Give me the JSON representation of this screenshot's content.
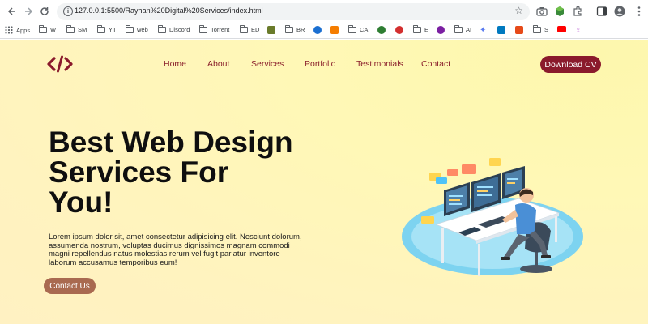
{
  "browser": {
    "url": "127.0.0.1:5500/Rayhan%20Digital%20Services/index.html",
    "bookmarks": [
      {
        "label": "Apps",
        "icon": "apps-grid-icon"
      },
      {
        "label": "W",
        "icon": "folder-icon"
      },
      {
        "label": "SM",
        "icon": "folder-icon"
      },
      {
        "label": "YT",
        "icon": "folder-icon"
      },
      {
        "label": "web",
        "icon": "folder-icon"
      },
      {
        "label": "Discord",
        "icon": "folder-icon"
      },
      {
        "label": "Torrent",
        "icon": "folder-icon"
      },
      {
        "label": "ED",
        "icon": "folder-icon"
      },
      {
        "label": "BR",
        "icon": "folder-icon"
      },
      {
        "label": "CA",
        "icon": "folder-icon"
      },
      {
        "label": "E",
        "icon": "folder-icon"
      },
      {
        "label": "AI",
        "icon": "folder-icon"
      },
      {
        "label": "S",
        "icon": "folder-icon"
      }
    ]
  },
  "header": {
    "logo_icon": "code-brackets-icon",
    "nav": [
      "Home",
      "About",
      "Services",
      "Portfolio",
      "Testimonials",
      "Contact"
    ],
    "cta_label": "Download CV"
  },
  "hero": {
    "title_lines": [
      "Best Web Design",
      "Services For",
      "You!"
    ],
    "text": "Lorem ipsum dolor sit, amet consectetur adipisicing elit. Nesciunt dolorum, assumenda nostrum, voluptas ducimus dignissimos magnam commodi magni repellendus natus molestias rerum vel fugit pariatur inventore laborum accusamus temporibus eum!",
    "button_label": "Contact Us"
  },
  "colors": {
    "brand": "#8a1a2c",
    "nav_text": "#8a1f2b",
    "contact_button": "#a96a50",
    "background": "#fff6b8"
  }
}
